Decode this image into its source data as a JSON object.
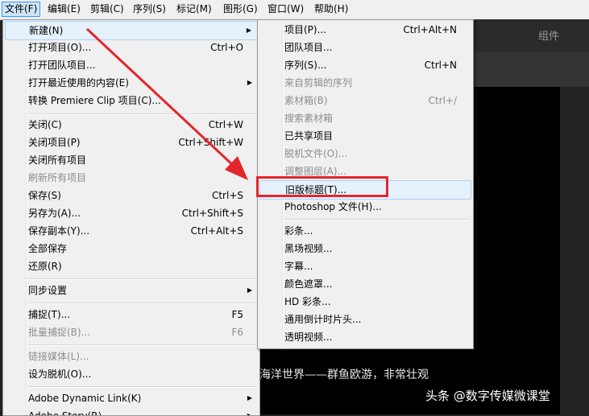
{
  "menubar": {
    "items": [
      {
        "label": "文件(F)",
        "active": true
      },
      {
        "label": "编辑(E)"
      },
      {
        "label": "剪辑(C)"
      },
      {
        "label": "序列(S)"
      },
      {
        "label": "标记(M)"
      },
      {
        "label": "图形(G)"
      },
      {
        "label": "窗口(W)"
      },
      {
        "label": "帮助(H)"
      }
    ]
  },
  "panel": {
    "tab_label": "组件"
  },
  "monitor": {
    "subtitle": "海洋世界——群鱼欧游，非常壮观"
  },
  "watermark": "头条 @数字传媒微课堂",
  "file_menu": {
    "items": [
      {
        "label": "新建(N)",
        "shortcut": "",
        "submenu": true
      },
      {
        "label": "打开项目(O)...",
        "shortcut": "Ctrl+O"
      },
      {
        "label": "打开团队项目..."
      },
      {
        "label": "打开最近使用的内容(E)",
        "submenu": true
      },
      {
        "label": "转换 Premiere Clip 项目(C)..."
      },
      {
        "label": "关闭(C)",
        "shortcut": "Ctrl+W"
      },
      {
        "label": "关闭项目(P)",
        "shortcut": "Ctrl+Shift+W"
      },
      {
        "label": "关闭所有项目"
      },
      {
        "label": "刷新所有项目",
        "disabled": true
      },
      {
        "label": "保存(S)",
        "shortcut": "Ctrl+S"
      },
      {
        "label": "另存为(A)...",
        "shortcut": "Ctrl+Shift+S"
      },
      {
        "label": "保存副本(Y)...",
        "shortcut": "Ctrl+Alt+S"
      },
      {
        "label": "全部保存"
      },
      {
        "label": "还原(R)"
      },
      {
        "label": "同步设置",
        "submenu": true
      },
      {
        "label": "捕捉(T)...",
        "shortcut": "F5"
      },
      {
        "label": "批量捕捉(B)...",
        "shortcut": "F6",
        "disabled": true
      },
      {
        "label": "链接媒体(L)...",
        "disabled": true
      },
      {
        "label": "设为脱机(O)..."
      },
      {
        "label": "Adobe Dynamic Link(K)",
        "submenu": true
      },
      {
        "label": "Adobe Story(R)",
        "submenu": true
      }
    ]
  },
  "new_submenu": {
    "items": [
      {
        "label": "项目(P)...",
        "shortcut": "Ctrl+Alt+N"
      },
      {
        "label": "团队项目..."
      },
      {
        "label": "序列(S)...",
        "shortcut": "Ctrl+N"
      },
      {
        "label": "来自剪辑的序列",
        "disabled": true
      },
      {
        "label": "素材箱(B)",
        "shortcut": "Ctrl+/",
        "disabled": true
      },
      {
        "label": "搜索素材箱",
        "disabled": true
      },
      {
        "label": "已共享项目"
      },
      {
        "label": "脱机文件(O)...",
        "disabled": true
      },
      {
        "label": "调整图层(A)...",
        "disabled": true
      },
      {
        "label": "旧版标题(T)...",
        "highlight": true
      },
      {
        "label": "Photoshop 文件(H)..."
      },
      {
        "label": "彩条..."
      },
      {
        "label": "黑场视频..."
      },
      {
        "label": "字幕..."
      },
      {
        "label": "颜色遮罩..."
      },
      {
        "label": "HD 彩条..."
      },
      {
        "label": "通用倒计时片头..."
      },
      {
        "label": "透明视频..."
      }
    ]
  },
  "colors": {
    "annotation_red": "#e3262b",
    "highlight_bg": "#e5f1fb",
    "disabled_text": "#8d8d8d"
  }
}
